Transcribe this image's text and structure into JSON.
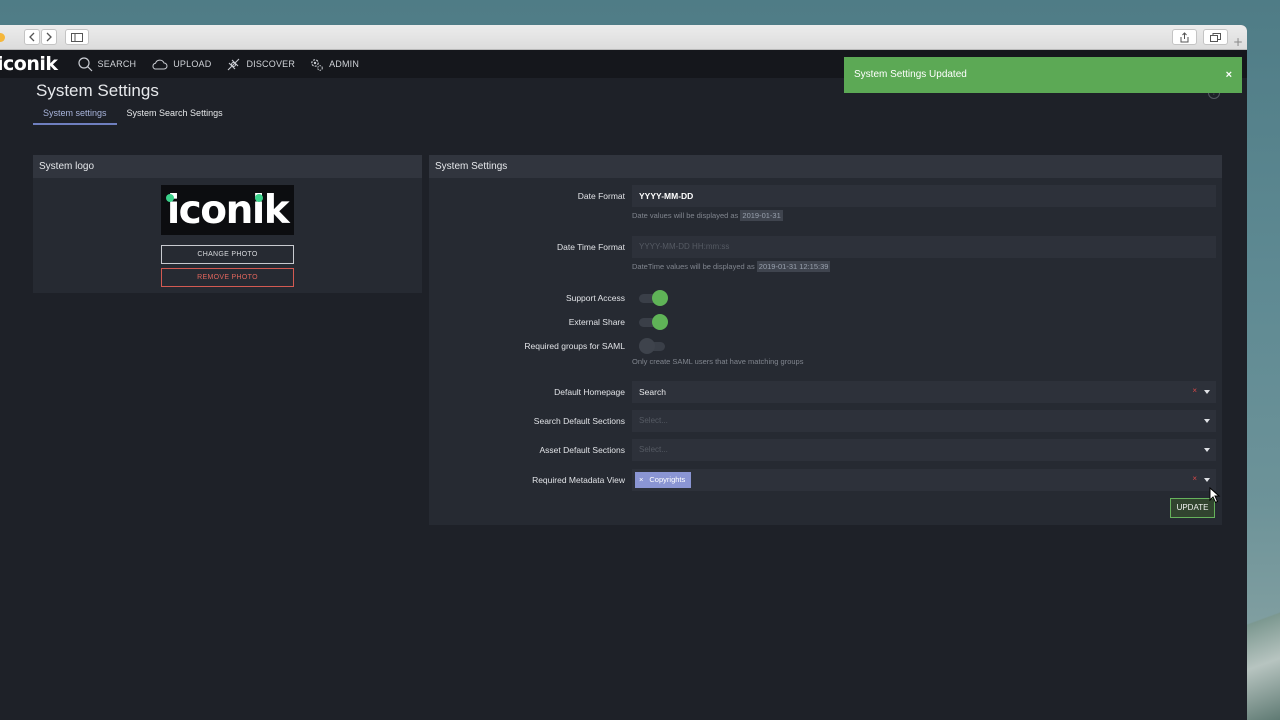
{
  "browser": {
    "back_icon": "chevron-left-icon",
    "forward_icon": "chevron-right-icon",
    "sidebar_icon": "sidebar-icon",
    "share_icon": "share-icon",
    "tabs_icon": "tabs-icon",
    "new_tab_label": "+"
  },
  "app": {
    "brand": "iconik",
    "nav": [
      {
        "label": "SEARCH",
        "icon": "search-icon"
      },
      {
        "label": "UPLOAD",
        "icon": "cloud-icon"
      },
      {
        "label": "DISCOVER",
        "icon": "discover-icon"
      },
      {
        "label": "ADMIN",
        "icon": "gear-icon"
      }
    ]
  },
  "page": {
    "title": "System Settings",
    "tabs": [
      {
        "label": "System settings",
        "active": true
      },
      {
        "label": "System Search Settings",
        "active": false
      }
    ],
    "help_label": "?"
  },
  "logo_panel": {
    "title": "System logo",
    "logo_text": "iconik",
    "change_label": "CHANGE PHOTO",
    "remove_label": "REMOVE PHOTO"
  },
  "settings_panel": {
    "title": "System Settings",
    "date_format": {
      "label": "Date Format",
      "value": "YYYY-MM-DD",
      "hint": "Date values will be displayed as",
      "hint_example": "2019-01-31"
    },
    "date_time_format": {
      "label": "Date Time Format",
      "placeholder": "YYYY-MM-DD HH:mm:ss",
      "hint": "DateTime values will be displayed as",
      "hint_example": "2019-01-31 12:15:39"
    },
    "support_access": {
      "label": "Support Access",
      "enabled": true
    },
    "external_share": {
      "label": "External Share",
      "enabled": true
    },
    "saml_groups": {
      "label": "Required groups for SAML",
      "enabled": false,
      "hint": "Only create SAML users that have matching groups"
    },
    "default_homepage": {
      "label": "Default Homepage",
      "value": "Search",
      "clear": "×"
    },
    "search_default_sections": {
      "label": "Search Default Sections",
      "placeholder": "Select..."
    },
    "asset_default_sections": {
      "label": "Asset Default Sections",
      "placeholder": "Select..."
    },
    "required_metadata_view": {
      "label": "Required Metadata View",
      "chip": "Copyrights",
      "chip_remove": "×",
      "clear": "×"
    },
    "update_label": "UPDATE"
  },
  "toast": {
    "message": "System Settings Updated",
    "close": "×",
    "color": "#5ca955"
  },
  "colors": {
    "accent": "#6f7fbf",
    "success": "#5fb357",
    "danger": "#d35a52"
  }
}
